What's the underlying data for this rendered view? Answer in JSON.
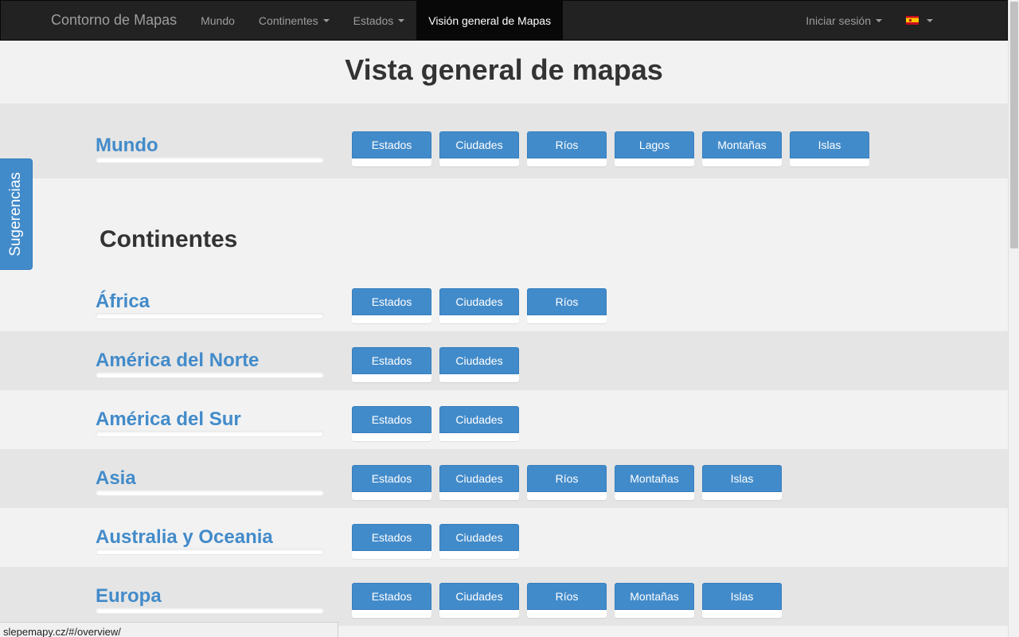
{
  "navbar": {
    "brand": "Contorno de Mapas",
    "links": [
      {
        "label": "Mundo",
        "dropdown": false
      },
      {
        "label": "Continentes",
        "dropdown": true
      },
      {
        "label": "Estados",
        "dropdown": true
      },
      {
        "label": "Visión general de Mapas",
        "dropdown": false,
        "active": true
      }
    ],
    "login": "Iniciar sesión",
    "language_icon": "spain-flag-icon"
  },
  "page_title": "Vista general de mapas",
  "world": {
    "name": "Mundo",
    "buttons": [
      "Estados",
      "Ciudades",
      "Ríos",
      "Lagos",
      "Montañas",
      "Islas"
    ]
  },
  "continents_title": "Continentes",
  "continents": [
    {
      "name": "África",
      "buttons": [
        "Estados",
        "Ciudades",
        "Ríos"
      ]
    },
    {
      "name": "América del Norte",
      "buttons": [
        "Estados",
        "Ciudades"
      ]
    },
    {
      "name": "América del Sur",
      "buttons": [
        "Estados",
        "Ciudades"
      ]
    },
    {
      "name": "Asia",
      "buttons": [
        "Estados",
        "Ciudades",
        "Ríos",
        "Montañas",
        "Islas"
      ]
    },
    {
      "name": "Australia y Oceania",
      "buttons": [
        "Estados",
        "Ciudades"
      ]
    },
    {
      "name": "Europa",
      "buttons": [
        "Estados",
        "Ciudades",
        "Ríos",
        "Montañas",
        "Islas"
      ]
    }
  ],
  "feedback_tab": "Sugerencias",
  "status_url": "slepemapy.cz/#/overview/",
  "colors": {
    "primary": "#428bca",
    "navbar": "#222222",
    "active_nav": "#080808"
  }
}
